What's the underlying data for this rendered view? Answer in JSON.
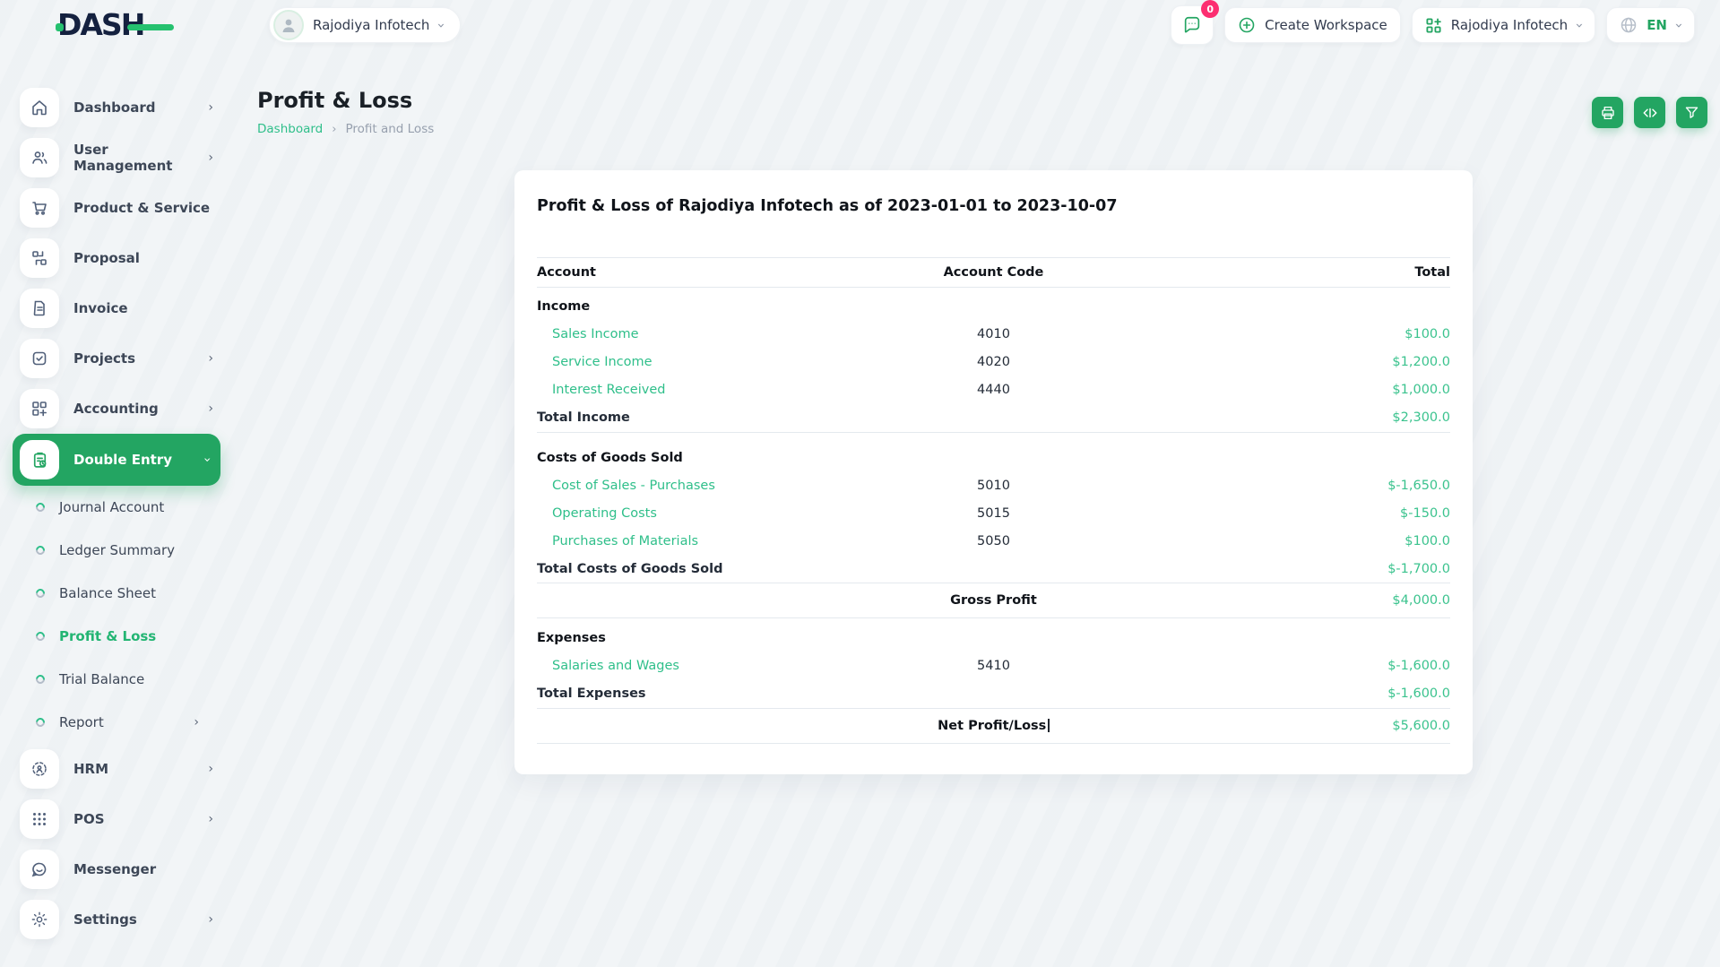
{
  "brand": {
    "name": "DASH"
  },
  "header": {
    "company_switcher": "Rajodiya Infotech",
    "messages_badge": "0",
    "create_workspace_label": "Create Workspace",
    "workspace_label": "Rajodiya Infotech",
    "language_code": "EN"
  },
  "page": {
    "title": "Profit & Loss",
    "breadcrumb": {
      "home": "Dashboard",
      "separator": "›",
      "current": "Profit and Loss"
    }
  },
  "sidebar": {
    "items": [
      {
        "label": "Dashboard"
      },
      {
        "label": "User Management"
      },
      {
        "label": "Product & Service"
      },
      {
        "label": "Proposal"
      },
      {
        "label": "Invoice"
      },
      {
        "label": "Projects"
      },
      {
        "label": "Accounting"
      },
      {
        "label": "Double Entry"
      },
      {
        "label": "Journal Account"
      },
      {
        "label": "Ledger Summary"
      },
      {
        "label": "Balance Sheet"
      },
      {
        "label": "Profit & Loss"
      },
      {
        "label": "Trial Balance"
      },
      {
        "label": "Report"
      },
      {
        "label": "HRM"
      },
      {
        "label": "POS"
      },
      {
        "label": "Messenger"
      },
      {
        "label": "Settings"
      }
    ]
  },
  "report": {
    "heading": "Profit & Loss of Rajodiya Infotech as of 2023-01-01 to 2023-10-07",
    "columns": {
      "account": "Account",
      "code": "Account Code",
      "total": "Total"
    },
    "rows": [
      {
        "type": "section",
        "label": "Income"
      },
      {
        "type": "account",
        "label": "Sales Income",
        "code": "4010",
        "total": "$100.0"
      },
      {
        "type": "account",
        "label": "Service Income",
        "code": "4020",
        "total": "$1,200.0"
      },
      {
        "type": "account",
        "label": "Interest Received",
        "code": "4440",
        "total": "$1,000.0"
      },
      {
        "type": "total",
        "label": "Total Income",
        "total": "$2,300.0"
      },
      {
        "type": "section",
        "label": "Costs of Goods Sold"
      },
      {
        "type": "account",
        "label": "Cost of Sales - Purchases",
        "code": "5010",
        "total": "$-1,650.0"
      },
      {
        "type": "account",
        "label": "Operating Costs",
        "code": "5015",
        "total": "$-150.0"
      },
      {
        "type": "account",
        "label": "Purchases of Materials",
        "code": "5050",
        "total": "$100.0"
      },
      {
        "type": "total",
        "label": "Total Costs of Goods Sold",
        "total": "$-1,700.0"
      },
      {
        "type": "summary",
        "label": "Gross Profit",
        "total": "$4,000.0"
      },
      {
        "type": "section",
        "label": "Expenses"
      },
      {
        "type": "account",
        "label": "Salaries and Wages",
        "code": "5410",
        "total": "$-1,600.0"
      },
      {
        "type": "total",
        "label": "Total Expenses",
        "total": "$-1,600.0"
      },
      {
        "type": "summary",
        "label": "Net Profit/Loss",
        "total": "$5,600.0"
      }
    ]
  },
  "colors": {
    "primary": "#23a562",
    "accent": "#3bc38e",
    "badge": "#fc2e71",
    "logo_green": "#25c16f",
    "logo_navy": "#14213f"
  }
}
